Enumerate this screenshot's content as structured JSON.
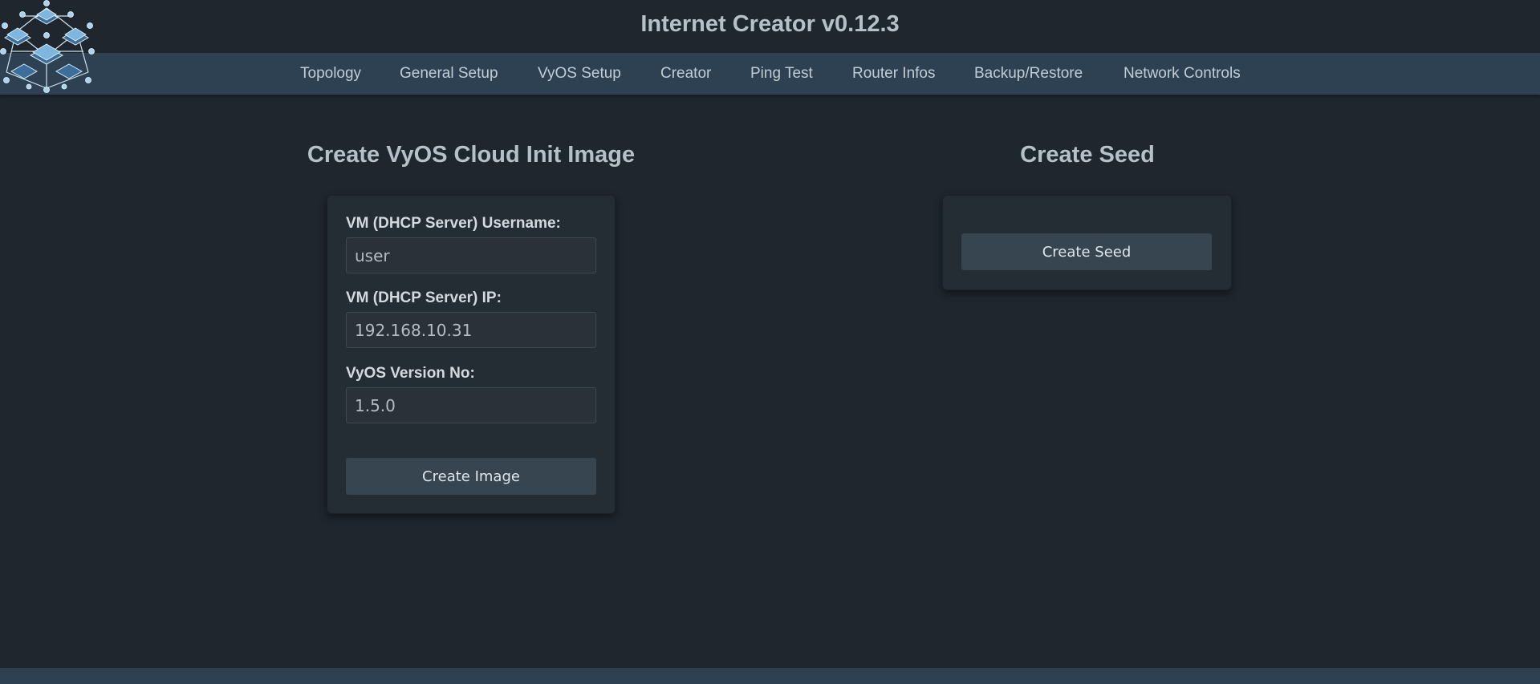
{
  "app": {
    "title": "Internet Creator v0.12.3",
    "logo_icon": "network-servers-logo"
  },
  "nav": {
    "items": [
      {
        "label": "Topology"
      },
      {
        "label": "General Setup"
      },
      {
        "label": "VyOS Setup"
      },
      {
        "label": "Creator"
      },
      {
        "label": "Ping Test"
      },
      {
        "label": "Router Infos"
      },
      {
        "label": "Backup/Restore"
      },
      {
        "label": "Network Controls"
      }
    ]
  },
  "image_section": {
    "title": "Create VyOS Cloud Init Image",
    "username_label": "VM (DHCP Server) Username:",
    "username_value": "user",
    "ip_label": "VM (DHCP Server) IP:",
    "ip_value": "192.168.10.31",
    "version_label": "VyOS Version No:",
    "version_value": "1.5.0",
    "button_label": "Create Image"
  },
  "seed_section": {
    "title": "Create Seed",
    "button_label": "Create Seed"
  },
  "colors": {
    "background": "#1f262e",
    "navbar": "#2e4153",
    "card": "#252d34",
    "button": "#36454f",
    "title_text": "#b5c0c8"
  }
}
